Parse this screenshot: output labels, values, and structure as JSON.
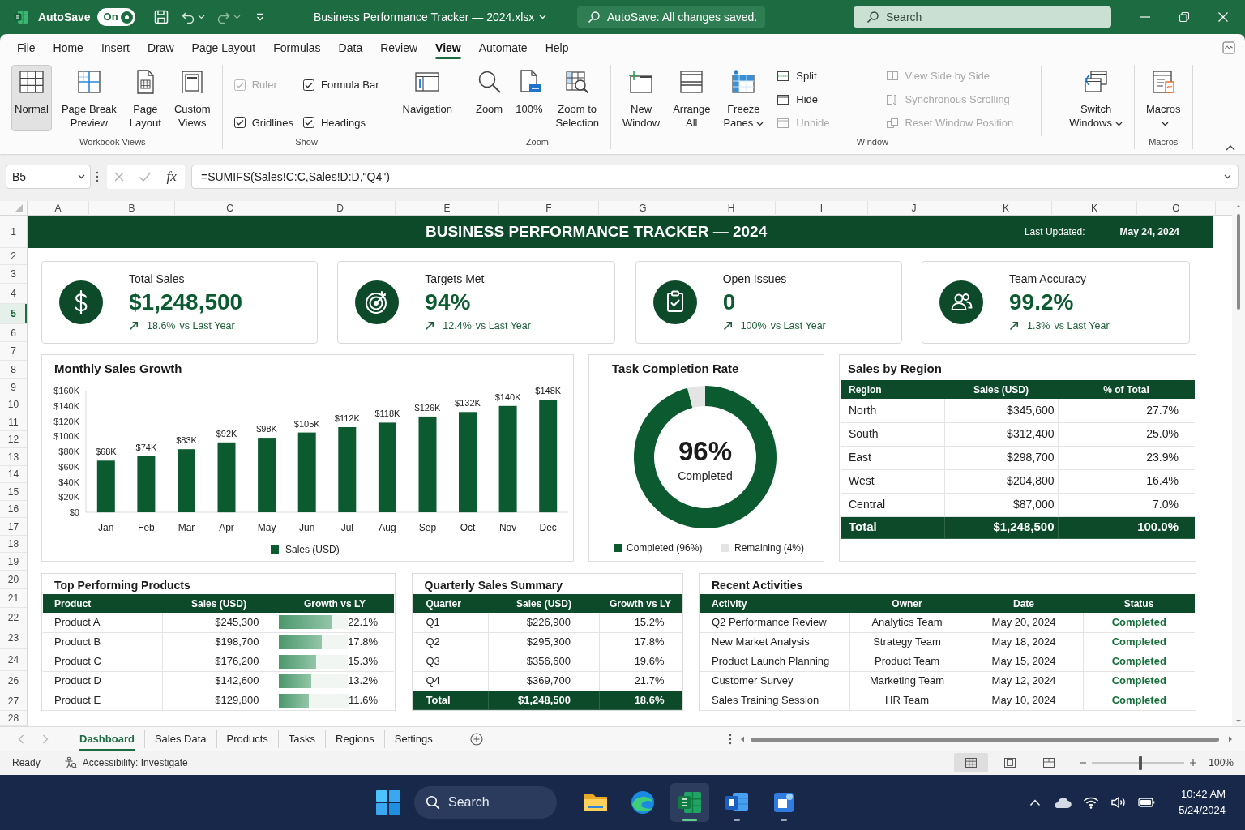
{
  "title_bar": {
    "autosave_label": "AutoSave",
    "autosave_toggle": {
      "label": "On",
      "on": true
    },
    "document_title": "Business Performance Tracker — 2024.xlsx",
    "save_status": "AutoSave: All changes saved.",
    "search": {
      "placeholder": "Search"
    }
  },
  "ribbon": {
    "tabs": [
      {
        "label": "File",
        "selected": false
      },
      {
        "label": "Home",
        "selected": false
      },
      {
        "label": "Insert",
        "selected": false
      },
      {
        "label": "Draw",
        "selected": false
      },
      {
        "label": "Page Layout",
        "selected": false
      },
      {
        "label": "Formulas",
        "selected": false
      },
      {
        "label": "Data",
        "selected": false
      },
      {
        "label": "Review",
        "selected": false
      },
      {
        "label": "View",
        "selected": true
      },
      {
        "label": "Automate",
        "selected": false
      },
      {
        "label": "Help",
        "selected": false
      }
    ],
    "groups": [
      {
        "label": "Workbook Views",
        "items": [
          {
            "kind": "large",
            "lines": [
              "Normal"
            ],
            "selected": true,
            "dropdown": false
          },
          {
            "kind": "large",
            "lines": [
              "Page Break",
              "Preview"
            ],
            "selected": false,
            "dropdown": false
          },
          {
            "kind": "large",
            "lines": [
              "Page",
              "Layout"
            ],
            "selected": false,
            "dropdown": false
          },
          {
            "kind": "large",
            "lines": [
              "Custom",
              "Views"
            ],
            "selected": false,
            "dropdown": false
          }
        ]
      },
      {
        "label": "Show",
        "items": [
          {
            "kind": "check",
            "label": "Ruler",
            "checked": true,
            "disabled": true
          },
          {
            "kind": "check",
            "label": "Formula Bar",
            "checked": true,
            "disabled": false
          },
          {
            "kind": "check",
            "label": "Gridlines",
            "checked": true,
            "disabled": false
          },
          {
            "kind": "check",
            "label": "Headings",
            "checked": true,
            "disabled": false
          }
        ]
      },
      {
        "items": [
          {
            "kind": "large",
            "lines": [
              "Navigation"
            ],
            "dropdown": false
          }
        ]
      },
      {
        "label": "Zoom",
        "items": [
          {
            "kind": "large",
            "lines": [
              "Zoom"
            ],
            "dropdown": false
          },
          {
            "kind": "large",
            "lines": [
              "100%"
            ],
            "dropdown": false
          },
          {
            "kind": "large",
            "lines": [
              "Zoom to",
              "Selection"
            ],
            "dropdown": false
          }
        ]
      },
      {
        "label": "Window",
        "items": [
          {
            "kind": "large",
            "lines": [
              "New",
              "Window"
            ],
            "dropdown": false
          },
          {
            "kind": "large",
            "lines": [
              "Arrange",
              "All"
            ],
            "dropdown": false
          },
          {
            "kind": "large",
            "lines": [
              "Freeze",
              "Panes"
            ],
            "dropdown": true
          },
          {
            "kind": "stack",
            "items": [
              {
                "label": "Split",
                "disabled": false
              },
              {
                "label": "Hide",
                "disabled": false
              },
              {
                "label": "Unhide",
                "disabled": true
              }
            ]
          },
          {
            "kind": "stack",
            "items": [
              {
                "label": "View Side by Side",
                "disabled": true
              },
              {
                "label": "Synchronous Scrolling",
                "disabled": true
              },
              {
                "label": "Reset Window Position",
                "disabled": true
              }
            ]
          },
          {
            "kind": "large",
            "lines": [
              "Switch",
              "Windows"
            ],
            "dropdown": true
          }
        ]
      },
      {
        "label": "Macros",
        "items": [
          {
            "kind": "large",
            "lines": [
              "Macros"
            ],
            "dropdown": true
          }
        ]
      }
    ]
  },
  "formula_bar": {
    "name_box": "B5",
    "function_label": "fx",
    "formula": "=SUMIFS(Sales!C:C,Sales!D:D,\"Q4\")"
  },
  "sheet": {
    "columns": [
      "A",
      "B",
      "C",
      "D",
      "E",
      "F",
      "G",
      "H",
      "I",
      "J",
      "K",
      "K",
      "O"
    ],
    "rows": [
      {
        "label": "1",
        "selected": false
      },
      {
        "label": "2",
        "selected": false
      },
      {
        "label": "3",
        "selected": false
      },
      {
        "label": "4",
        "selected": false
      },
      {
        "label": "5",
        "selected": true
      },
      {
        "label": "6",
        "selected": false
      },
      {
        "label": "7",
        "selected": false
      },
      {
        "label": "8",
        "selected": false
      },
      {
        "label": "9",
        "selected": false
      },
      {
        "label": "10",
        "selected": false
      },
      {
        "label": "11",
        "selected": false
      },
      {
        "label": "12",
        "selected": false
      },
      {
        "label": "13",
        "selected": false
      },
      {
        "label": "14",
        "selected": false
      },
      {
        "label": "15",
        "selected": false
      },
      {
        "label": "16",
        "selected": false
      },
      {
        "label": "17",
        "selected": false
      },
      {
        "label": "18",
        "selected": false
      },
      {
        "label": "19",
        "selected": false
      },
      {
        "label": "20",
        "selected": false
      },
      {
        "label": "21",
        "selected": false
      },
      {
        "label": "22",
        "selected": false
      },
      {
        "label": "23",
        "selected": false
      },
      {
        "label": "24",
        "selected": false
      },
      {
        "label": "26",
        "selected": false
      },
      {
        "label": "27",
        "selected": false
      },
      {
        "label": "28",
        "selected": false
      }
    ],
    "dashboard": {
      "title": "BUSINESS PERFORMANCE TRACKER — 2024",
      "last_updated_label": "Last Updated:",
      "last_updated": "May 24, 2024",
      "kpis": [
        {
          "label": "Total Sales",
          "value": "$1,248,500",
          "change": "18.6%",
          "comparison": "vs Last Year"
        },
        {
          "label": "Targets Met",
          "value": "94%",
          "change": "12.4%",
          "comparison": "vs Last Year"
        },
        {
          "label": "Open Issues",
          "value": "0",
          "change": "100%",
          "comparison": "vs Last Year"
        },
        {
          "label": "Team Accuracy",
          "value": "99.2%",
          "change": "1.3%",
          "comparison": "vs Last Year"
        }
      ],
      "monthly_sales": {
        "chart_data": {
          "type": "bar",
          "title": "Monthly Sales Growth",
          "categories": [
            "Jan",
            "Feb",
            "Mar",
            "Apr",
            "May",
            "Jun",
            "Jul",
            "Aug",
            "Sep",
            "Oct",
            "Nov",
            "Dec"
          ],
          "series": [
            {
              "name": "Sales (USD)",
              "color": "#0b5a30",
              "values": [
                68000,
                74000,
                83000,
                92000,
                98000,
                105000,
                112000,
                118000,
                126000,
                132000,
                140000,
                148000
              ]
            }
          ],
          "ylim": [
            0,
            160000
          ],
          "yticks": [
            {
              "value": 0,
              "label": "$0"
            },
            {
              "value": 20000,
              "label": "$20K"
            },
            {
              "value": 40000,
              "label": "$40K"
            },
            {
              "value": 60000,
              "label": "$60K"
            },
            {
              "value": 80000,
              "label": "$80K"
            },
            {
              "value": 100000,
              "label": "$100K"
            },
            {
              "value": 120000,
              "label": "$120K"
            },
            {
              "value": 140000,
              "label": "$140K"
            },
            {
              "value": 160000,
              "label": "$160K"
            }
          ],
          "value_labels": [
            "$68K",
            "$74K",
            "$83K",
            "$92K",
            "$98K",
            "$105K",
            "$112K",
            "$118K",
            "$126K",
            "$132K",
            "$140K",
            "$148K"
          ],
          "legend": "bottom"
        }
      },
      "task_completion": {
        "chart_data": {
          "type": "donut",
          "title": "Task Completion Rate",
          "categories": [
            "Completed (96%)",
            "Remaining (4%)"
          ],
          "values": [
            96,
            4
          ],
          "colors": [
            "#0b5a30",
            "#e4e4e4"
          ],
          "legend": "bottom"
        },
        "center_value": "96%",
        "center_label": "Completed"
      },
      "sales_by_region": {
        "title": "Sales by Region",
        "columns": [
          "Region",
          "Sales (USD)",
          "% of Total"
        ],
        "rows": [
          [
            "North",
            "$345,600",
            "27.7%"
          ],
          [
            "South",
            "$312,400",
            "25.0%"
          ],
          [
            "East",
            "$298,700",
            "23.9%"
          ],
          [
            "West",
            "$204,800",
            "16.4%"
          ],
          [
            "Central",
            "$87,000",
            "7.0%"
          ]
        ],
        "total": [
          "Total",
          "$1,248,500",
          "100.0%"
        ]
      },
      "top_products": {
        "title": "Top Performing Products",
        "columns": [
          "Product",
          "Sales (USD)",
          "Growth vs LY"
        ],
        "rows": [
          {
            "product": "Product A",
            "sales": "$245,300",
            "growth": "22.1%",
            "level": 0.78
          },
          {
            "product": "Product B",
            "sales": "$198,700",
            "growth": "17.8%",
            "level": 0.63
          },
          {
            "product": "Product C",
            "sales": "$176,200",
            "growth": "15.3%",
            "level": 0.54
          },
          {
            "product": "Product D",
            "sales": "$142,600",
            "growth": "13.2%",
            "level": 0.47
          },
          {
            "product": "Product E",
            "sales": "$129,800",
            "growth": "11.6%",
            "level": 0.43
          }
        ]
      },
      "quarterly_sales": {
        "title": "Quarterly Sales Summary",
        "columns": [
          "Quarter",
          "Sales (USD)",
          "Growth vs LY"
        ],
        "rows": [
          [
            "Q1",
            "$226,900",
            "15.2%"
          ],
          [
            "Q2",
            "$295,300",
            "17.8%"
          ],
          [
            "Q3",
            "$356,600",
            "19.6%"
          ],
          [
            "Q4",
            "$369,700",
            "21.7%"
          ]
        ],
        "total": [
          "Total",
          "$1,248,500",
          "18.6%"
        ]
      },
      "recent_activities": {
        "title": "Recent Activities",
        "columns": [
          "Activity",
          "Owner",
          "Date",
          "Status"
        ],
        "rows": [
          [
            "Q2 Performance Review",
            "Analytics Team",
            "May 20, 2024",
            "Completed"
          ],
          [
            "New Market Analysis",
            "Strategy Team",
            "May 18, 2024",
            "Completed"
          ],
          [
            "Product Launch Planning",
            "Product Team",
            "May 15, 2024",
            "Completed"
          ],
          [
            "Customer Survey",
            "Marketing Team",
            "May 12, 2024",
            "Completed"
          ],
          [
            "Sales Training Session",
            "HR Team",
            "May 10, 2024",
            "Completed"
          ]
        ]
      }
    }
  },
  "sheet_tabs": [
    {
      "label": "Dashboard",
      "selected": true
    },
    {
      "label": "Sales Data",
      "selected": false
    },
    {
      "label": "Products",
      "selected": false
    },
    {
      "label": "Tasks",
      "selected": false
    },
    {
      "label": "Regions",
      "selected": false
    },
    {
      "label": "Settings",
      "selected": false
    }
  ],
  "status_bar": {
    "mode": "Ready",
    "accessibility": "Accessibility: Investigate",
    "view_buttons": [
      {
        "selected": true
      },
      {
        "selected": false
      },
      {
        "selected": false
      }
    ],
    "zoom": {
      "level": 0.52,
      "label": "100%"
    }
  },
  "taskbar": {
    "search": {
      "placeholder": "Search"
    },
    "apps": [
      {
        "kind": "folder",
        "active": false,
        "running": false
      },
      {
        "kind": "browser",
        "active": false,
        "running": false
      },
      {
        "kind": "spreadsheet",
        "active": true,
        "running": true
      },
      {
        "kind": "p-tile",
        "active": false,
        "running": true
      },
      {
        "kind": "help-tile",
        "active": false,
        "running": true
      }
    ],
    "time": "10:42 AM",
    "date": "5/24/2024"
  }
}
